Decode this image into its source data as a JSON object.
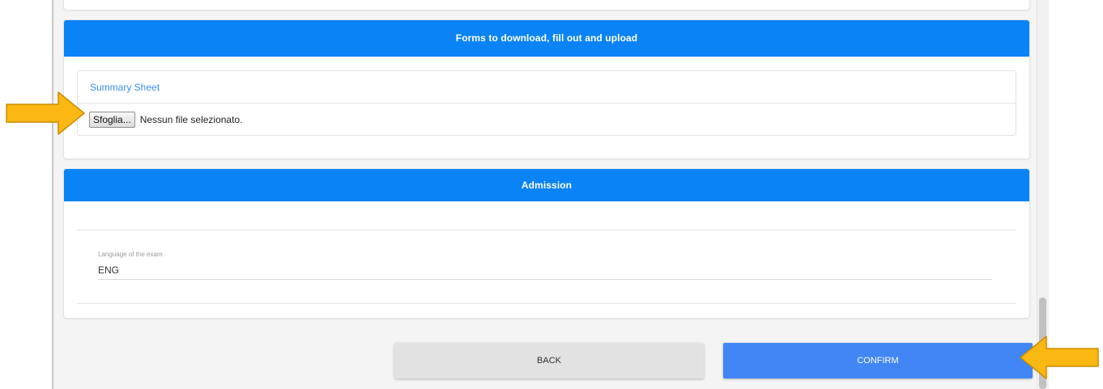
{
  "forms_section": {
    "title": "Forms to download, fill out and upload",
    "summary_sheet": {
      "label": "Summary Sheet",
      "browse_label": "Sfoglia...",
      "file_status": "Nessun file selezionato."
    }
  },
  "admission_section": {
    "title": "Admission",
    "language_field": {
      "label": "Language of the exam",
      "value": "ENG"
    }
  },
  "actions": {
    "back_label": "BACK",
    "confirm_label": "CONFIRM"
  },
  "colors": {
    "header_blue": "#0a83f6",
    "confirm_blue": "#4286f5",
    "link_blue": "#3b8ef0",
    "annotation_arrow": "#fbb712"
  },
  "annotations": {
    "arrow_icon": "arrow-right-icon / arrow-left-icon"
  }
}
